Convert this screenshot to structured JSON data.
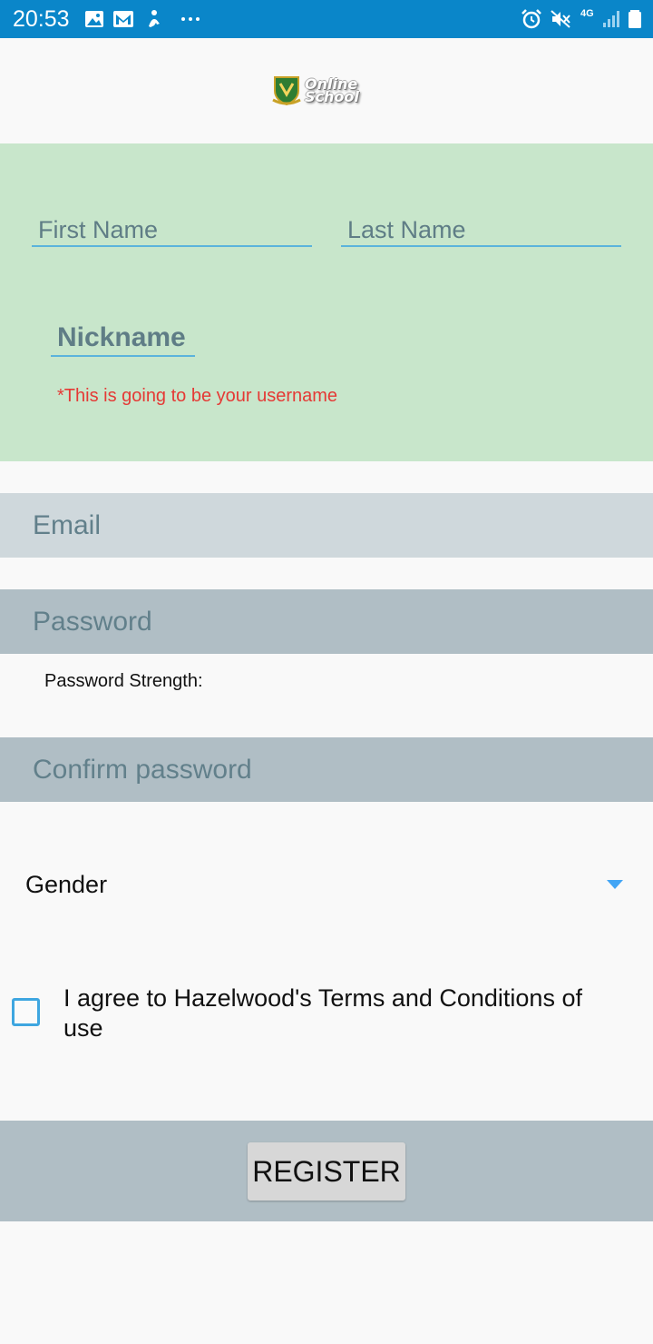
{
  "status_bar": {
    "time": "20:53",
    "network": "4G",
    "icons": [
      "gallery-icon",
      "mail-icon",
      "fitness-icon",
      "more-dots-icon",
      "alarm-icon",
      "mute-icon",
      "signal-icon",
      "battery-icon"
    ],
    "color": "#0a86c9"
  },
  "logo": {
    "line1": "Online",
    "line2": "School"
  },
  "name_section": {
    "first_name_placeholder": "First Name",
    "last_name_placeholder": "Last Name",
    "nickname_placeholder": "Nickname",
    "nickname_hint": "*This is going to be your username",
    "background": "#c8e6cb"
  },
  "email": {
    "placeholder": "Email",
    "background": "#cfd8dc"
  },
  "password": {
    "placeholder": "Password",
    "strength_label": "Password Strength:",
    "background": "#b0bec5"
  },
  "confirm_password": {
    "placeholder": "Confirm password",
    "background": "#b0bec5"
  },
  "gender": {
    "label": "Gender"
  },
  "terms": {
    "label": "I agree to Hazelwood's Terms and Conditions of use",
    "checked": false
  },
  "register": {
    "label": "REGISTER"
  }
}
